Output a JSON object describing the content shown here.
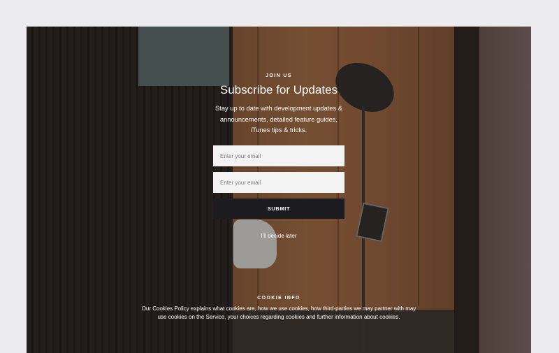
{
  "subscribe": {
    "eyebrow": "JOIN US",
    "title": "Subscribe for Updates",
    "description": "Stay up to date with development updates & announcements, detailed feature guides, iTunes tips & tricks.",
    "email_placeholder_1": "Enter your email",
    "email_placeholder_2": "Enter your email",
    "submit_label": "SUBMIT",
    "later_label": "I'll decide later"
  },
  "cookie": {
    "title": "COOKIE INFO",
    "text": "Our Cookies Policy explains what cookies are, how we use cookies, how third-parties we may partner with may use cookies on the Service, your choices regarding cookies and further information about cookies."
  },
  "colors": {
    "page_background": "#ececee",
    "button": "#1c1b1f",
    "input": "#f3f3f3",
    "text": "#ffffff"
  }
}
